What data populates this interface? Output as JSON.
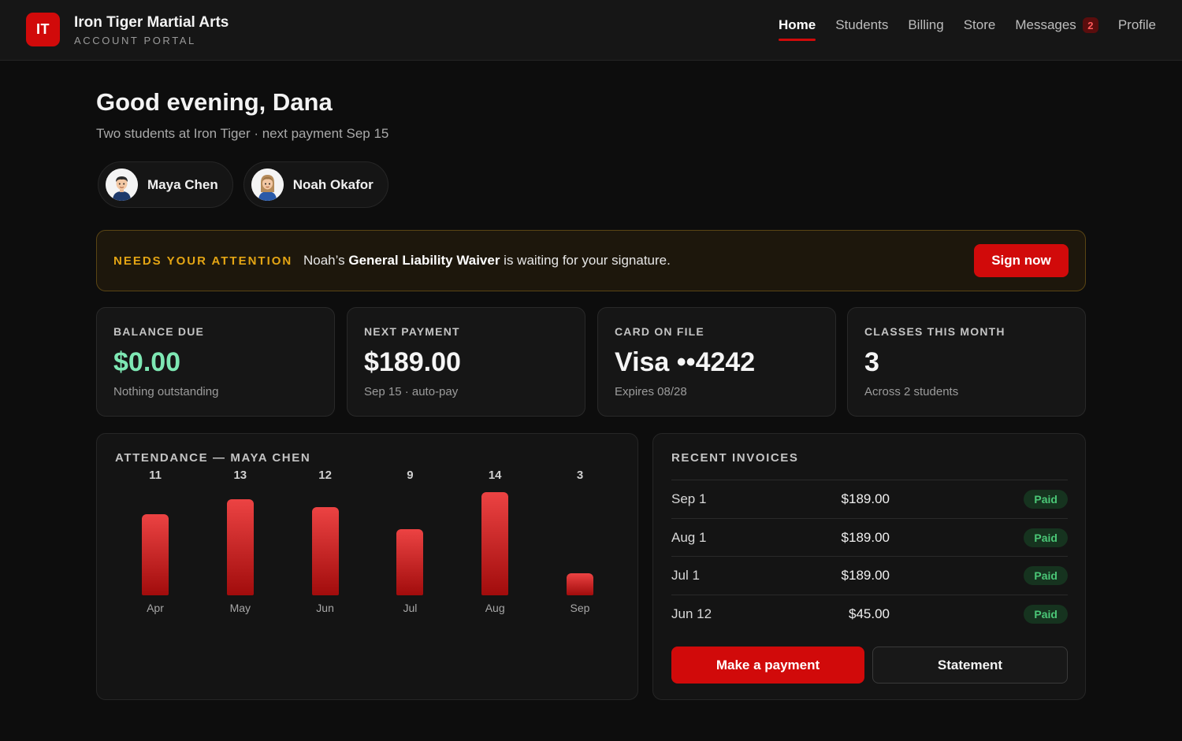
{
  "header": {
    "logo_text": "IT",
    "brand_name": "Iron Tiger Martial Arts",
    "brand_sub": "ACCOUNT PORTAL",
    "nav": [
      {
        "label": "Home",
        "active": true
      },
      {
        "label": "Students"
      },
      {
        "label": "Billing"
      },
      {
        "label": "Store"
      },
      {
        "label": "Messages",
        "badge": "2"
      },
      {
        "label": "Profile"
      }
    ]
  },
  "greeting": {
    "title": "Good evening, Dana",
    "subtitle": "Two students at Iron Tiger · next payment Sep 15"
  },
  "students": [
    {
      "name": "Maya Chen",
      "avatar": "boy-avatar-icon"
    },
    {
      "name": "Noah Okafor",
      "avatar": "girl-avatar-icon"
    }
  ],
  "attention": {
    "label": "NEEDS YOUR ATTENTION",
    "text_before": "Noah’s ",
    "text_bold": "General Liability Waiver",
    "text_after": " is waiting for your signature.",
    "button": "Sign now"
  },
  "stats": [
    {
      "label": "BALANCE DUE",
      "value": "$0.00",
      "note": "Nothing outstanding",
      "accent": "#7ee8b4"
    },
    {
      "label": "NEXT PAYMENT",
      "value": "$189.00",
      "note": "Sep 15 · auto-pay"
    },
    {
      "label": "CARD ON FILE",
      "value": "Visa ••4242",
      "note": "Expires 08/28"
    },
    {
      "label": "CLASSES THIS MONTH",
      "value": "3",
      "note": "Across 2 students"
    }
  ],
  "attendance": {
    "title": "ATTENDANCE — MAYA CHEN"
  },
  "chart_data": {
    "type": "bar",
    "title": "ATTENDANCE — MAYA CHEN",
    "categories": [
      "Apr",
      "May",
      "Jun",
      "Jul",
      "Aug",
      "Sep"
    ],
    "values": [
      11,
      13,
      12,
      9,
      14,
      3
    ],
    "ylim": [
      0,
      14
    ],
    "grid": false,
    "color": "#d10a0a"
  },
  "invoices": {
    "title": "RECENT INVOICES",
    "rows": [
      {
        "date": "Sep 1",
        "amount": "$189.00",
        "status": "Paid"
      },
      {
        "date": "Aug 1",
        "amount": "$189.00",
        "status": "Paid"
      },
      {
        "date": "Jul 1",
        "amount": "$189.00",
        "status": "Paid"
      },
      {
        "date": "Jun 12",
        "amount": "$45.00",
        "status": "Paid"
      }
    ],
    "pay_button": "Make a payment",
    "statement_button": "Statement"
  },
  "colors": {
    "accent": "#d10a0a",
    "warning": "#e4a514",
    "success": "#4bc777",
    "balance_green": "#7ee8b4"
  }
}
